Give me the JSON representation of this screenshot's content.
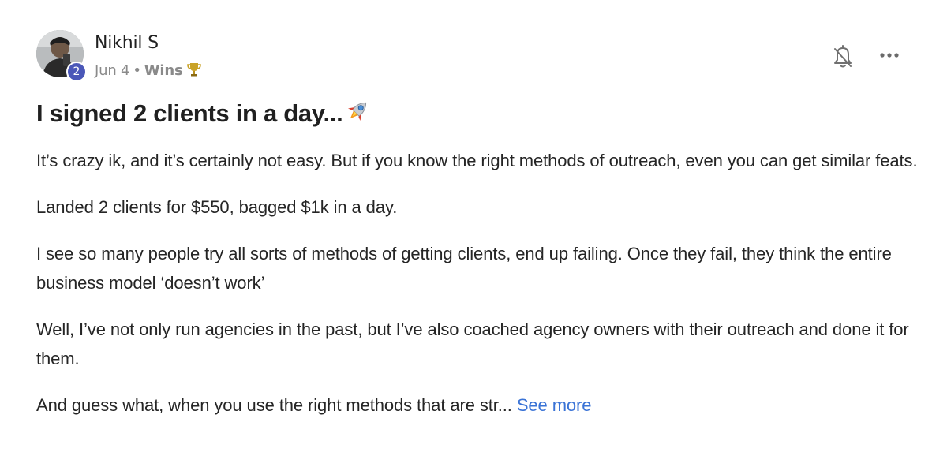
{
  "post": {
    "author": {
      "name": "Nikhil S",
      "level": "2"
    },
    "meta": {
      "date": "Jun 4",
      "separator": "•",
      "category": "Wins"
    },
    "title": "I signed 2 clients in a day...",
    "paragraphs": [
      "It’s crazy ik, and it’s certainly not easy. But if you know the right methods of outreach, even you can get similar feats.",
      "Landed 2 clients for $550, bagged $1k in a day.",
      "I see so many people try all sorts of methods of getting clients, end up failing. Once they fail, they think the entire business model ‘doesn’t work’",
      "Well, I’ve not only run agencies in the past, but I’ve also coached agency owners with their outreach and done it for them."
    ],
    "last_paragraph": "And guess what, when you use the right methods that are str...",
    "see_more": "See more",
    "icons": {
      "bell": "bell-off-icon",
      "more": "more-horizontal-icon",
      "trophy": "trophy-icon",
      "rocket": "rocket-icon"
    },
    "colors": {
      "badge": "#4a57b8",
      "link": "#3a73d6",
      "meta_text": "#8a8a8a",
      "text": "#252525"
    }
  }
}
